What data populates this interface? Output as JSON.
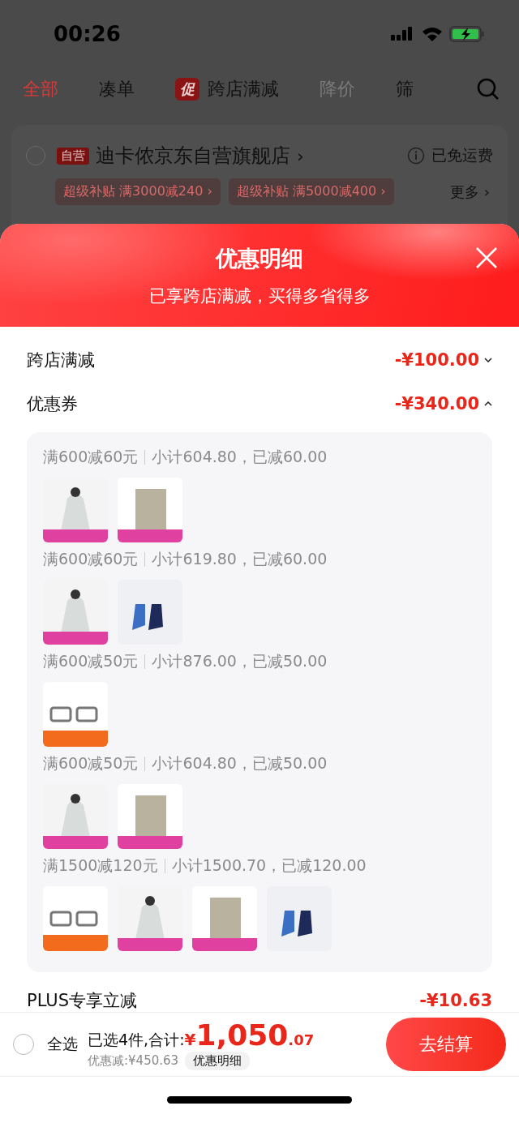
{
  "status_bar": {
    "time": "00:26"
  },
  "tabs": [
    {
      "label": "全部",
      "selected": true,
      "disabled": false
    },
    {
      "label": "凑单",
      "selected": false,
      "disabled": false
    },
    {
      "label": "跨店满减",
      "badge": "促",
      "selected": false,
      "disabled": false
    },
    {
      "label": "降价",
      "selected": false,
      "disabled": true
    },
    {
      "label": "筛",
      "selected": false,
      "disabled": false
    }
  ],
  "store": {
    "checked": false,
    "tag": "自营",
    "name": "迪卡侬京东自营旗舰店",
    "chevron": "›",
    "shipping": "已免运费",
    "promos": [
      "超级补贴 满3000减240 ›",
      "超级补贴 满5000减400 ›"
    ],
    "more": "更多 ›"
  },
  "sheet": {
    "title": "优惠明细",
    "subtitle": "已享跨店满减，买得多省得多",
    "rows": [
      {
        "label": "跨店满减",
        "amount": "-¥100.00",
        "kind": "collapsible",
        "expanded": false
      },
      {
        "label": "优惠券",
        "amount": "-¥340.00",
        "kind": "collapsible",
        "expanded": true
      }
    ],
    "coupons": [
      {
        "rule": "满600减60元",
        "detail": "小计604.80，已减60.00",
        "products": [
          {
            "kind": "jacket"
          },
          {
            "kind": "pack"
          }
        ]
      },
      {
        "rule": "满600减60元",
        "detail": "小计619.80，已减60.00",
        "products": [
          {
            "kind": "jacket"
          },
          {
            "kind": "socks"
          }
        ]
      },
      {
        "rule": "满600减50元",
        "detail": "小计876.00，已减50.00",
        "products": [
          {
            "kind": "glasses"
          }
        ]
      },
      {
        "rule": "满600减50元",
        "detail": "小计604.80，已减50.00",
        "products": [
          {
            "kind": "jacket"
          },
          {
            "kind": "pack"
          }
        ]
      },
      {
        "rule": "满1500减120元",
        "detail": "小计1500.70，已减120.00",
        "products": [
          {
            "kind": "glasses"
          },
          {
            "kind": "jacket"
          },
          {
            "kind": "pack"
          },
          {
            "kind": "socks"
          }
        ]
      }
    ],
    "plus": {
      "label": "PLUS专享立减",
      "amount": "-¥10.63"
    }
  },
  "footer": {
    "select_all": {
      "label": "全选",
      "checked": false
    },
    "summary": "已选4件,合计:",
    "currency": "¥",
    "integer": "1,050",
    "decimal": ".07",
    "discount": "优惠减:¥450.63",
    "details_button": "优惠明细",
    "checkout": "去结算"
  }
}
